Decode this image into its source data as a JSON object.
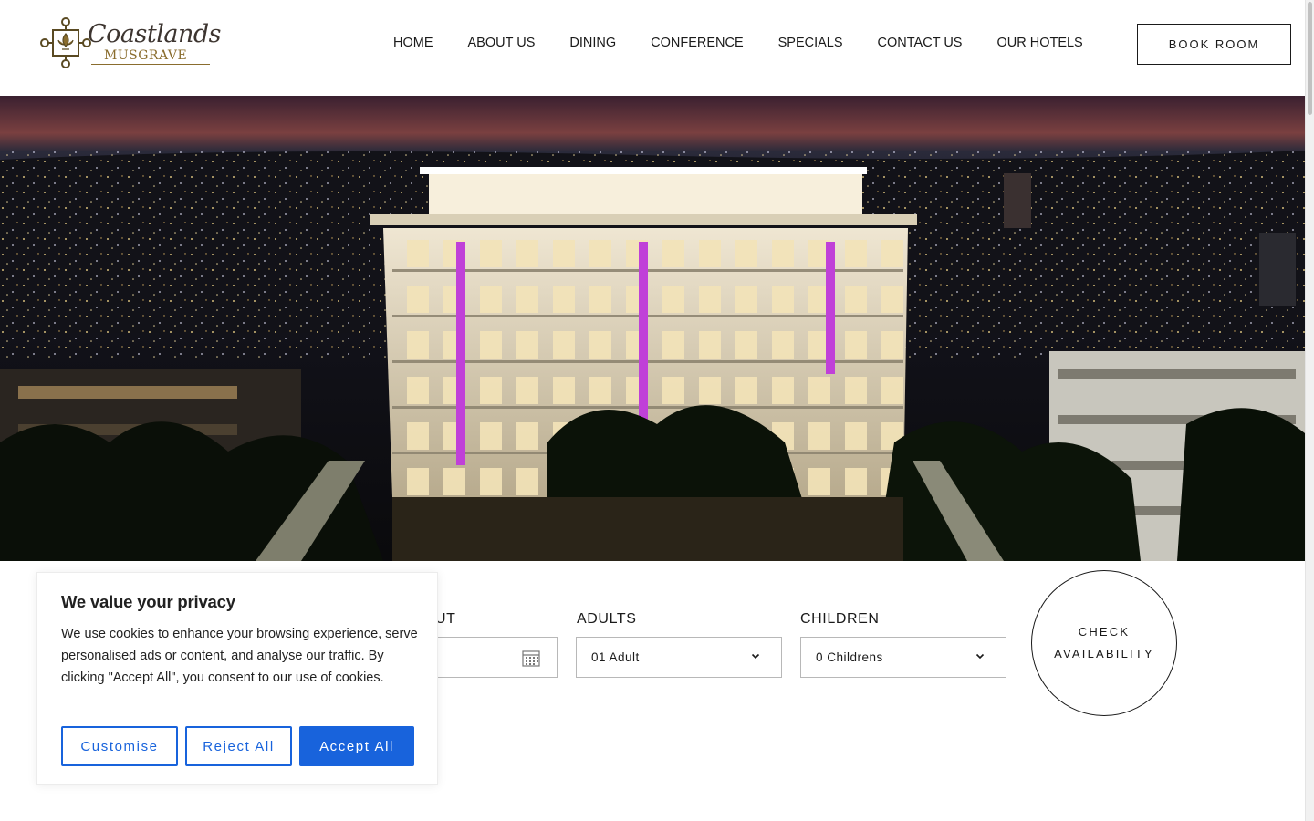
{
  "header": {
    "logo": {
      "name": "Coastlands",
      "subtitle": "MUSGRAVE"
    },
    "nav": [
      "HOME",
      "ABOUT US",
      "DINING",
      "CONFERENCE",
      "SPECIALS",
      "CONTACT US",
      "OUR HOTELS"
    ],
    "book_button": "BOOK ROOM"
  },
  "booking": {
    "checkout_label_partial": "UT",
    "adults_label": "ADULTS",
    "adults_value": "01 Adult",
    "children_label": "CHILDREN",
    "children_value": "0 Childrens",
    "check_line1": "CHECK",
    "check_line2": "AVAILABILITY"
  },
  "cookie": {
    "title": "We value your privacy",
    "text": "We use cookies to enhance your browsing experience, serve personalised ads or content, and analyse our traffic. By clicking \"Accept All\", you consent to our use of cookies.",
    "customise": "Customise",
    "reject": "Reject All",
    "accept": "Accept All"
  },
  "colors": {
    "accent": "#1863dc",
    "logo_gold": "#8a6d2e"
  },
  "icons": [
    "fleur-de-lis-logo-icon",
    "calendar-icon",
    "chevron-down-icon"
  ]
}
